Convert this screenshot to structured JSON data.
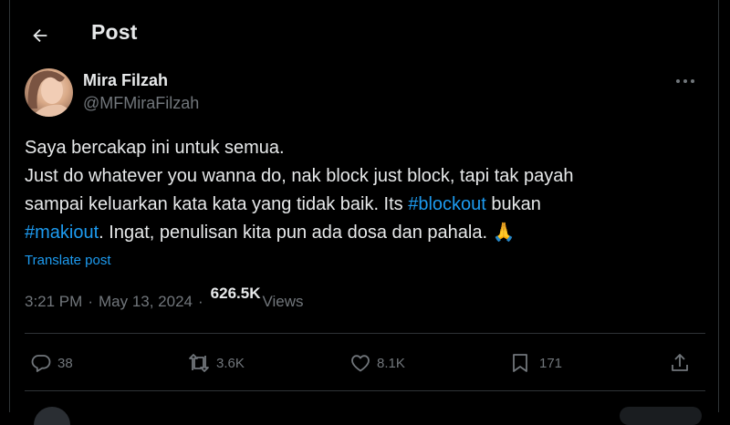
{
  "header": {
    "title": "Post"
  },
  "author": {
    "name": "Mira Filzah",
    "handle": "@MFMiraFilzah"
  },
  "post": {
    "line1": "Saya bercakap ini untuk semua.",
    "line2": "Just do whatever you wanna do, nak block just block, tapi tak payah",
    "line3_pre": "sampai keluarkan kata kata yang tidak baik. Its ",
    "hashtag1": "#blockout",
    "line3_post": " bukan",
    "hashtag2": "#makiout",
    "line4_post": ". Ingat, penulisan kita pun ada dosa dan pahala. 🙏",
    "translate": "Translate post"
  },
  "meta": {
    "time": "3:21 PM",
    "separator": "·",
    "date": "May 13, 2024",
    "views_count": "626.5K",
    "views_label": "Views"
  },
  "actions": {
    "replies": "38",
    "reposts": "3.6K",
    "likes": "8.1K",
    "bookmarks": "171"
  },
  "colors": {
    "accent": "#1d9bf0",
    "muted": "#71767b",
    "text": "#e7e9ea",
    "background": "#000000"
  },
  "icons": [
    "back-arrow-icon",
    "more-icon",
    "reply-icon",
    "repost-icon",
    "like-icon",
    "bookmark-icon",
    "share-icon"
  ]
}
